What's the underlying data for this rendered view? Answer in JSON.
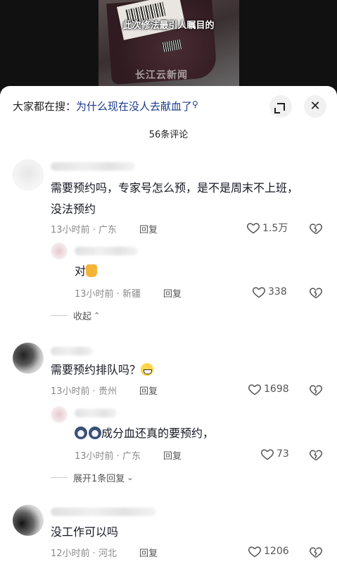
{
  "video": {
    "caption": "此次修法最引人瞩目的",
    "watermark": "长江云新闻"
  },
  "search": {
    "prefix": "大家都在搜：",
    "query": "为什么现在没人去献血了",
    "icon": "search-icon"
  },
  "header": {
    "expand_icon": "expand-icon",
    "close_icon": "close-icon",
    "count": "56条评论"
  },
  "comments": [
    {
      "text_line1": "需要预约吗，专家号怎么预，是不是周末不上班，",
      "text_line2": "没法预约",
      "time": "13小时前 · 广东",
      "reply": "回复",
      "likes": "1.5万",
      "replies": [
        {
          "text": "对",
          "emoji": "thumbs-up-emoji",
          "time": "13小时前 · 新疆",
          "reply": "回复",
          "likes": "338"
        }
      ],
      "fold_label": "收起"
    },
    {
      "text": "需要预约排队吗？",
      "emoji": "grin-emoji",
      "time": "13小时前 · 贵州",
      "reply": "回复",
      "likes": "1698",
      "replies": [
        {
          "text": "成分血还真的要预约，",
          "emoji": "cat-emoji",
          "time": "13小时前 · 广东",
          "reply": "回复",
          "likes": "73"
        }
      ],
      "expand_label": "展开1条回复"
    },
    {
      "text": "没工作可以吗",
      "time": "12小时前 · 河北",
      "reply": "回复",
      "likes": "1206"
    }
  ]
}
